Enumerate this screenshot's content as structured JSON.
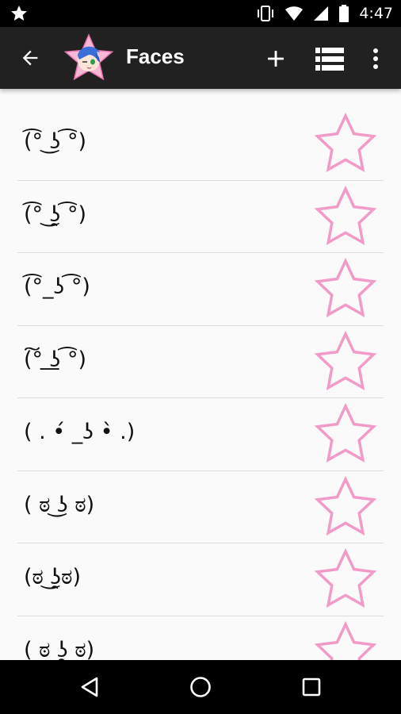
{
  "status_bar": {
    "time": "4:47",
    "icons": [
      "star-icon",
      "vibrate-icon",
      "wifi-icon",
      "signal-icon",
      "battery-icon"
    ]
  },
  "app_bar": {
    "title": "Faces",
    "icons": [
      "back-arrow-icon",
      "app-logo",
      "add-icon",
      "list-view-icon",
      "more-vert-icon"
    ]
  },
  "faces": [
    {
      "text": "(͡° ͜ʖ ͡°)",
      "favorited": false
    },
    {
      "text": "(͡° ͜ʖ̯ ͡°)",
      "favorited": false
    },
    {
      "text": "(͡°_ʖ ͡°)",
      "favorited": false
    },
    {
      "text": "(͠° ͟ʖ ͡°)",
      "favorited": false
    },
    {
      "text": "( . •́ _ʖ •̀ .)",
      "favorited": false
    },
    {
      "text": "( ಠ ͜ʖ ಠ)",
      "favorited": false
    },
    {
      "text": "(ಠ ͜ʖ̯ಠ)",
      "favorited": false
    },
    {
      "text": "( ಠ ʖ̯ ಠ)",
      "favorited": false
    }
  ],
  "colors": {
    "status_bar": "#000000",
    "app_bar": "#212121",
    "background": "#fafafa",
    "star_stroke": "#f29ac8",
    "divider": "#dcdcdc"
  },
  "nav_bar": {
    "icons": [
      "back-triangle-icon",
      "home-circle-icon",
      "recents-square-icon"
    ]
  }
}
